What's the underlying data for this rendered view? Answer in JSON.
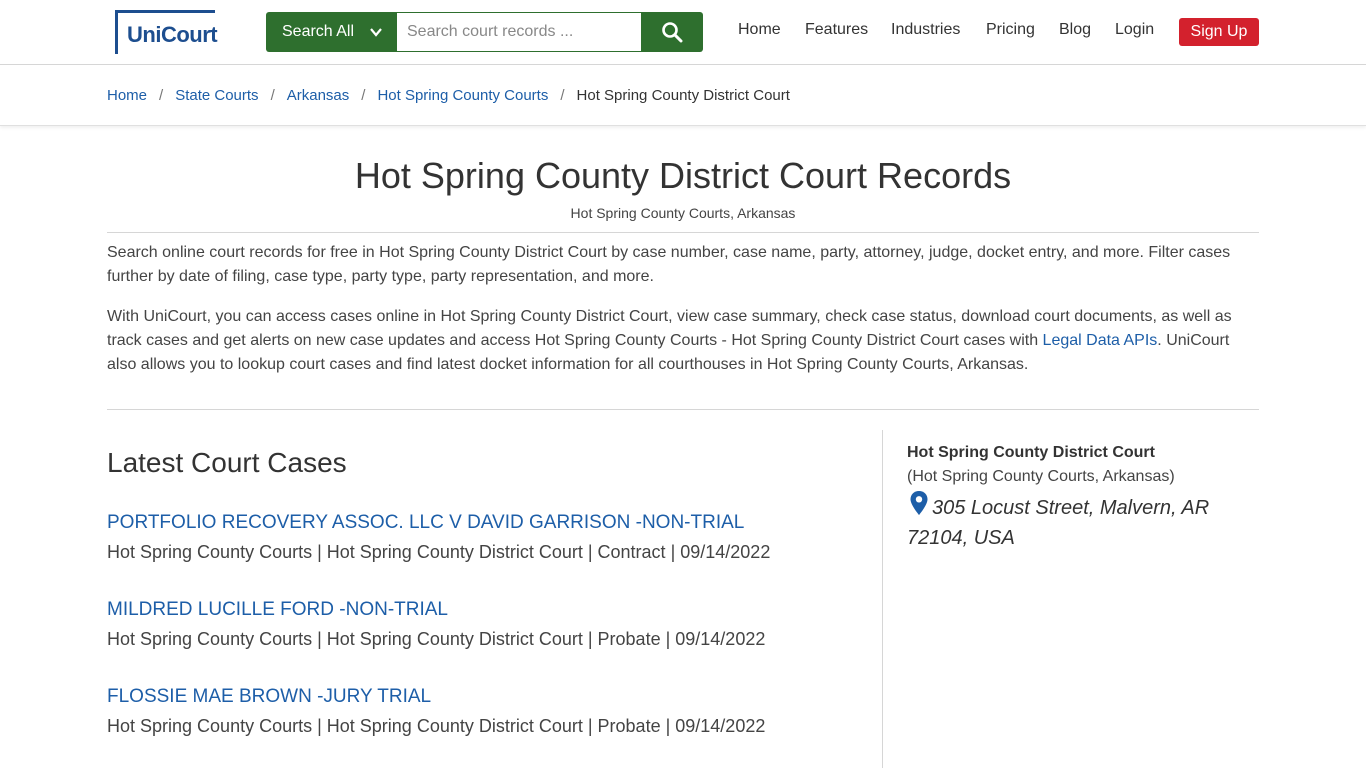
{
  "header": {
    "logo_text": "UniCourt",
    "search_all_label": "Search All",
    "search_placeholder": "Search court records ...",
    "nav": [
      "Home",
      "Features",
      "Industries",
      "Pricing",
      "Blog",
      "Login"
    ],
    "signup_label": "Sign Up"
  },
  "breadcrumb": {
    "links": [
      "Home",
      "State Courts",
      "Arkansas",
      "Hot Spring County Courts"
    ],
    "current": "Hot Spring County District Court"
  },
  "page": {
    "title": "Hot Spring County District Court Records",
    "subtitle": "Hot Spring County Courts, Arkansas",
    "para1": "Search online court records for free in Hot Spring County District Court by case number, case name, party, attorney, judge, docket entry, and more. Filter cases further by date of filing, case type, party type, party representation, and more.",
    "para2_before": "With UniCourt, you can access cases online in Hot Spring County District Court, view case summary, check case status, download court documents, as well as track cases and get alerts on new case updates and access Hot Spring County Courts - Hot Spring County District Court cases with ",
    "para2_link": "Legal Data APIs",
    "para2_after": ". UniCourt also allows you to lookup court cases and find latest docket information for all courthouses in Hot Spring County Courts, Arkansas."
  },
  "latest": {
    "heading": "Latest Court Cases",
    "cases": [
      {
        "title": "PORTFOLIO RECOVERY ASSOC. LLC V DAVID GARRISON -NON-TRIAL",
        "meta": "Hot Spring County Courts | Hot Spring County District Court | Contract | 09/14/2022"
      },
      {
        "title": "MILDRED LUCILLE FORD -NON-TRIAL",
        "meta": "Hot Spring County Courts | Hot Spring County District Court | Probate | 09/14/2022"
      },
      {
        "title": "FLOSSIE MAE BROWN -JURY TRIAL",
        "meta": "Hot Spring County Courts | Hot Spring County District Court | Probate | 09/14/2022"
      }
    ]
  },
  "sidebar": {
    "court_name": "Hot Spring County District Court",
    "court_sub": "(Hot Spring County Courts, Arkansas)",
    "address": "305 Locust Street, Malvern, AR 72104, USA",
    "pin_icon": "map-pin-icon"
  },
  "colors": {
    "brand_blue": "#1d4e8f",
    "link_blue": "#1d5ea8",
    "search_green": "#2e6f2e",
    "signup_red": "#d3212d"
  }
}
